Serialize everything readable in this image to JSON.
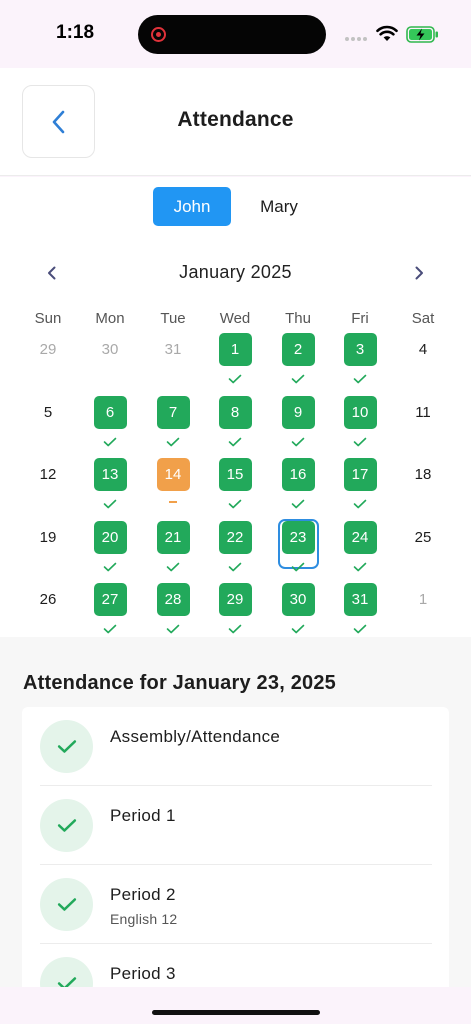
{
  "status_bar": {
    "time": "1:18"
  },
  "header": {
    "title": "Attendance"
  },
  "students": [
    {
      "name": "John",
      "selected": true
    },
    {
      "name": "Mary",
      "selected": false
    }
  ],
  "calendar": {
    "month_label": "January 2025",
    "weekdays": [
      "Sun",
      "Mon",
      "Tue",
      "Wed",
      "Thu",
      "Fri",
      "Sat"
    ],
    "selected_day": "23",
    "weeks": [
      [
        {
          "d": "29",
          "s": "muted"
        },
        {
          "d": "30",
          "s": "muted"
        },
        {
          "d": "31",
          "s": "muted"
        },
        {
          "d": "1",
          "s": "present"
        },
        {
          "d": "2",
          "s": "present"
        },
        {
          "d": "3",
          "s": "present"
        },
        {
          "d": "4",
          "s": "none"
        }
      ],
      [
        {
          "d": "5",
          "s": "none"
        },
        {
          "d": "6",
          "s": "present"
        },
        {
          "d": "7",
          "s": "present"
        },
        {
          "d": "8",
          "s": "present"
        },
        {
          "d": "9",
          "s": "present"
        },
        {
          "d": "10",
          "s": "present"
        },
        {
          "d": "11",
          "s": "none"
        }
      ],
      [
        {
          "d": "12",
          "s": "none"
        },
        {
          "d": "13",
          "s": "present"
        },
        {
          "d": "14",
          "s": "late"
        },
        {
          "d": "15",
          "s": "present"
        },
        {
          "d": "16",
          "s": "present"
        },
        {
          "d": "17",
          "s": "present"
        },
        {
          "d": "18",
          "s": "none"
        }
      ],
      [
        {
          "d": "19",
          "s": "none"
        },
        {
          "d": "20",
          "s": "present"
        },
        {
          "d": "21",
          "s": "present"
        },
        {
          "d": "22",
          "s": "present"
        },
        {
          "d": "23",
          "s": "present"
        },
        {
          "d": "24",
          "s": "present"
        },
        {
          "d": "25",
          "s": "none"
        }
      ],
      [
        {
          "d": "26",
          "s": "none"
        },
        {
          "d": "27",
          "s": "present"
        },
        {
          "d": "28",
          "s": "present"
        },
        {
          "d": "29",
          "s": "present"
        },
        {
          "d": "30",
          "s": "present"
        },
        {
          "d": "31",
          "s": "present"
        },
        {
          "d": "1",
          "s": "muted"
        }
      ]
    ],
    "colors": {
      "present": "#22a95b",
      "late": "#f1a04a",
      "selected_ring": "#2e8de0",
      "tab_active": "#2196f3"
    }
  },
  "detail": {
    "title": "Attendance for January 23, 2025",
    "periods": [
      {
        "name": "Assembly/Attendance",
        "subject": "",
        "status_icon": "check-icon"
      },
      {
        "name": "Period 1",
        "subject": "",
        "status_icon": "check-icon"
      },
      {
        "name": "Period 2",
        "subject": "English 12",
        "status_icon": "check-icon"
      },
      {
        "name": "Period 3",
        "subject": "",
        "status_icon": "check-icon"
      }
    ]
  }
}
